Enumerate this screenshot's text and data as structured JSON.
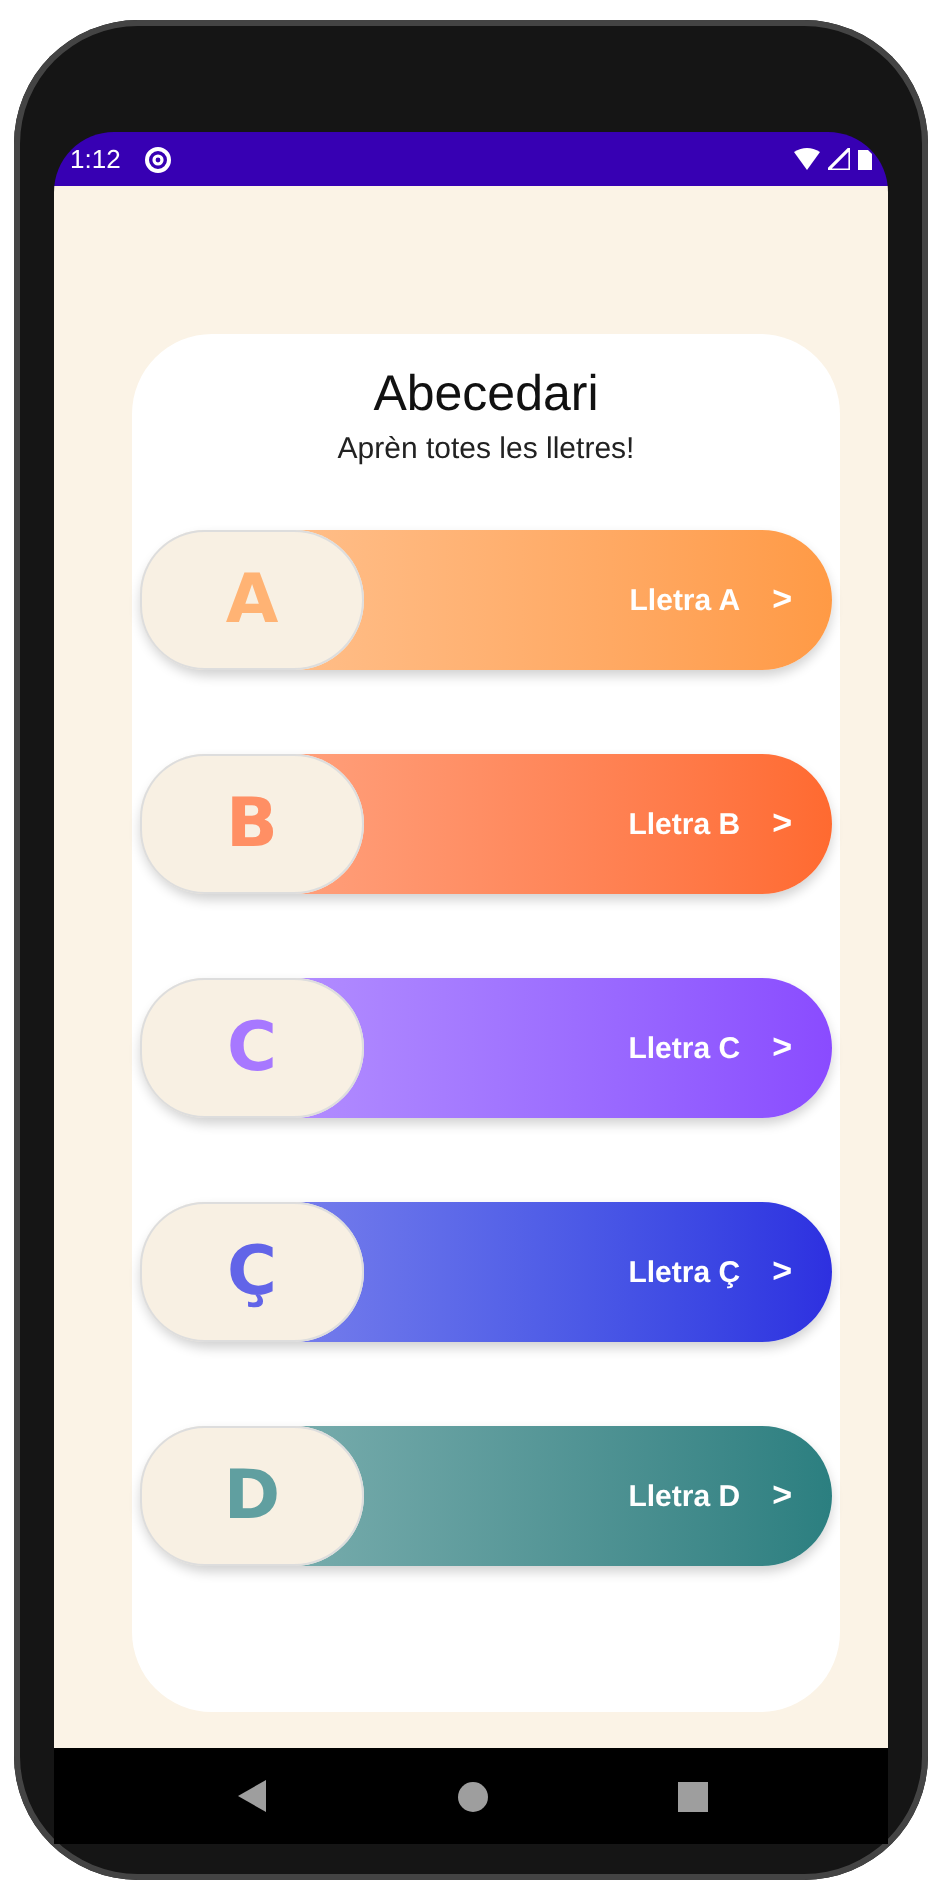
{
  "status_bar": {
    "time": "1:12"
  },
  "title": "Abecedari",
  "subtitle": "Aprèn totes les lletres!",
  "letters": [
    {
      "letter": "A",
      "label": "Lletra A",
      "chevron": ">",
      "color": "#ff9a45"
    },
    {
      "letter": "B",
      "label": "Lletra B",
      "chevron": ">",
      "color": "#ff6a30"
    },
    {
      "letter": "C",
      "label": "Lletra C",
      "chevron": ">",
      "color": "#8a4bff"
    },
    {
      "letter": "Ç",
      "label": "Lletra Ç",
      "chevron": ">",
      "color": "#2e30e0"
    },
    {
      "letter": "D",
      "label": "Lletra D",
      "chevron": ">",
      "color": "#2b7f80"
    }
  ]
}
